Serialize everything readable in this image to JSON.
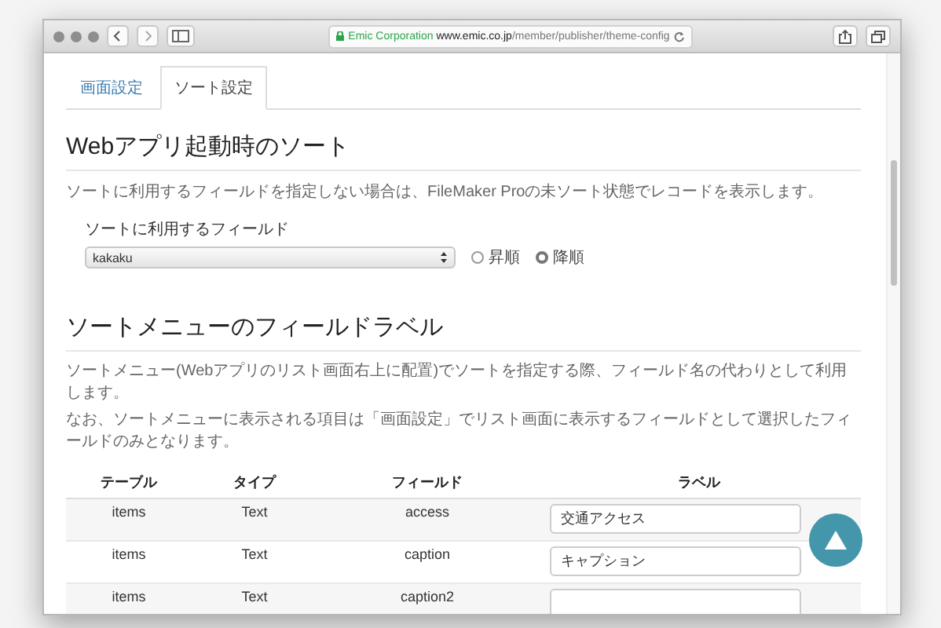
{
  "browser": {
    "url_org": "Emic Corporation",
    "url_domain": "www.emic.co.jp",
    "url_path": "/member/publisher/theme-config"
  },
  "tabs": [
    {
      "label": "画面設定",
      "selected": false
    },
    {
      "label": "ソート設定",
      "selected": true
    }
  ],
  "startup_sort": {
    "title": "Webアプリ起動時のソート",
    "description": "ソートに利用するフィールドを指定しない場合は、FileMaker Proの未ソート状態でレコードを表示します。",
    "field_label": "ソートに利用するフィールド",
    "field_value": "kakaku",
    "orders": [
      {
        "label": "昇順",
        "selected": false
      },
      {
        "label": "降順",
        "selected": true
      }
    ]
  },
  "menu_labels": {
    "title": "ソートメニューのフィールドラベル",
    "description": [
      "ソートメニュー(Webアプリのリスト画面右上に配置)でソートを指定する際、フィールド名の代わりとして利用します。",
      "なお、ソートメニューに表示される項目は「画面設定」でリスト画面に表示するフィールドとして選択したフィールドのみとなります。"
    ],
    "columns": [
      "テーブル",
      "タイプ",
      "フィールド",
      "ラベル"
    ],
    "rows": [
      {
        "table": "items",
        "type": "Text",
        "field": "access",
        "label": "交通アクセス"
      },
      {
        "table": "items",
        "type": "Text",
        "field": "caption",
        "label": "キャプション"
      },
      {
        "table": "items",
        "type": "Text",
        "field": "caption2"
      }
    ]
  }
}
